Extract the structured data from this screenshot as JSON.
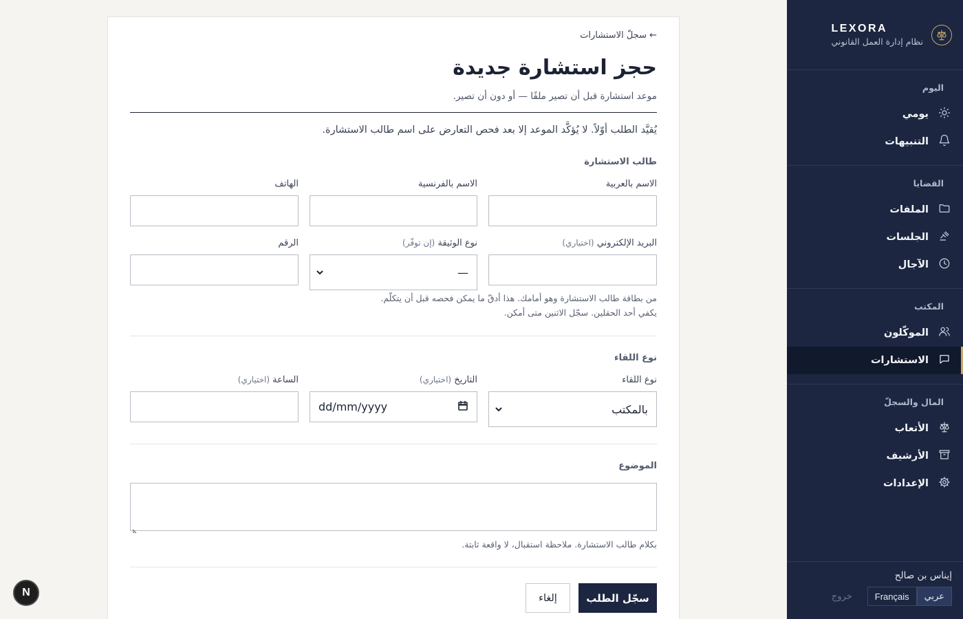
{
  "brand": {
    "name": "LEXORA",
    "subtitle": "نظام إدارة العمل القانوني"
  },
  "sidebar": {
    "groups": [
      {
        "heading": "اليوم",
        "items": [
          {
            "label": "يومي",
            "icon": "sun-icon"
          },
          {
            "label": "التنبيهات",
            "icon": "bell-icon"
          }
        ]
      },
      {
        "heading": "القضايا",
        "items": [
          {
            "label": "الملفات",
            "icon": "folder-icon"
          },
          {
            "label": "الجلسات",
            "icon": "gavel-icon"
          },
          {
            "label": "الآجال",
            "icon": "clock-icon"
          }
        ]
      },
      {
        "heading": "المكتب",
        "items": [
          {
            "label": "الموكّلون",
            "icon": "users-icon"
          },
          {
            "label": "الاستشارات",
            "icon": "chat-icon",
            "active": true
          }
        ]
      },
      {
        "heading": "المال والسجلّ",
        "items": [
          {
            "label": "الأتعاب",
            "icon": "scale-icon"
          },
          {
            "label": "الأرشيف",
            "icon": "archive-icon"
          },
          {
            "label": "الإعدادات",
            "icon": "gear-icon"
          }
        ]
      }
    ],
    "footer": {
      "user_name": "إيناس بن صالح",
      "lang_ar": "عربي",
      "lang_fr": "Français",
      "logout": "خروج"
    }
  },
  "page": {
    "back_link": "← سجلّ الاستشارات",
    "title": "حجز استشارة جديدة",
    "subtitle": "موعد استشارة قبل أن تصير ملفًا — أو دون أن تصير.",
    "intro": "يُقيَّد الطلب أوّلاً. لا يُؤكَّد الموعد إلا بعد فحص التعارض على اسم طالب الاستشارة."
  },
  "requester": {
    "heading": "طالب الاستشارة",
    "name_ar_label": "الاسم بالعربية",
    "name_fr_label": "الاسم بالفرنسية",
    "phone_label": "الهاتف",
    "email_label": "البريد الإلكتروني",
    "email_optional": "(اختياري)",
    "doc_type_label": "نوع الوثيقة",
    "doc_type_optional": "(إن توفّر)",
    "doc_type_value": "—",
    "number_label": "الرقم",
    "hint_line1": "من بطاقة طالب الاستشارة وهو أمامك. هذا أدقّ ما يمكن فحصه قبل أن يتكلّم.",
    "hint_line2": "يكفي أحد الحقلين. سجّل الاثنين متى أمكن."
  },
  "meeting": {
    "heading": "نوع اللقاء",
    "type_label": "نوع اللقاء",
    "type_value": "بالمكتب",
    "date_label": "التاريخ",
    "date_optional": "(اختياري)",
    "date_placeholder": "dd/mm/yyyy",
    "time_label": "الساعة",
    "time_optional": "(اختياري)"
  },
  "subject": {
    "heading": "الموضوع",
    "hint": "بكلام طالب الاستشارة. ملاحظة استقبال، لا واقعة ثابتة."
  },
  "actions": {
    "submit": "سجّل الطلب",
    "cancel": "إلغاء"
  },
  "dev_badge": "N"
}
